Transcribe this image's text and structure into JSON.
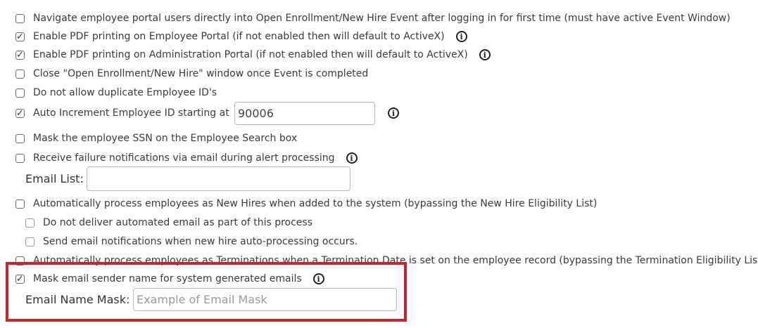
{
  "options": [
    {
      "label": "Navigate employee portal users directly into Open Enrollment/New Hire Event after logging in for first time (must have active Event Window)",
      "checked": false
    },
    {
      "label": "Enable PDF printing on Employee Portal (if not enabled then will default to ActiveX)",
      "checked": true,
      "info": true
    },
    {
      "label": "Enable PDF printing on Administration Portal (if not enabled then will default to ActiveX)",
      "checked": true,
      "info": true
    },
    {
      "label": "Close \"Open Enrollment/New Hire\" window once Event is completed",
      "checked": false
    },
    {
      "label": "Do not allow duplicate Employee ID's",
      "checked": false
    },
    {
      "label": "Auto Increment Employee ID starting at",
      "checked": true,
      "info": true
    },
    {
      "label": "Mask the employee SSN on the Employee Search box",
      "checked": false
    },
    {
      "label": "Receive failure notifications via email during alert processing",
      "checked": false,
      "info": true
    },
    {
      "label": "Automatically process employees as New Hires when added to the system (bypassing the New Hire Eligibility List)",
      "checked": false
    },
    {
      "label": "Do not deliver automated email as part of this process",
      "checked": false
    },
    {
      "label": "Send email notifications when new hire auto-processing occurs.",
      "checked": false
    },
    {
      "label": "Automatically process employees as Terminations when a Termination Date is set on the employee record (bypassing the Termination Eligibility List)",
      "checked": false
    },
    {
      "label": "Mask email sender name for system generated emails",
      "checked": true,
      "info": true
    }
  ],
  "auto_increment_value": "90006",
  "email_list": {
    "label": "Email List:",
    "value": ""
  },
  "email_name_mask": {
    "label": "Email Name Mask:",
    "placeholder": "Example of Email Mask"
  },
  "check_glyph": "✓",
  "info_glyph": "i",
  "highlight_color": "#c0282e"
}
